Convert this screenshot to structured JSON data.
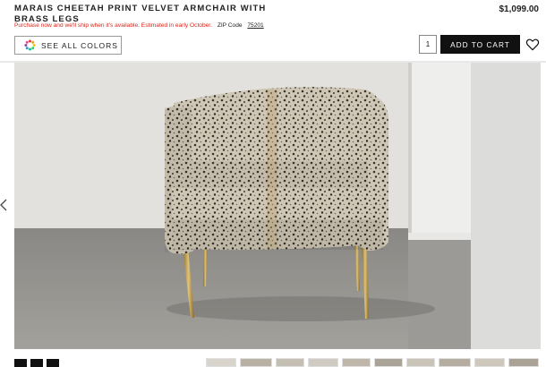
{
  "product": {
    "title": "MARAIS CHEETAH PRINT VELVET ARMCHAIR WITH BRASS LEGS",
    "price": "$1,099.00",
    "shipping_message": "Purchase now and we'll ship when it's available. Estimated in early October.",
    "zip_label": "ZIP Code",
    "zip_code": "75201"
  },
  "actions": {
    "see_colors_label": "SEE ALL COLORS",
    "quantity": "1",
    "add_to_cart_label": "ADD TO CART"
  },
  "icons": {
    "color_wheel": "color-wheel-icon",
    "wishlist": "heart-icon",
    "previous": "chevron-left-icon"
  },
  "colors": {
    "shipping_text": "#d6261b",
    "button_bg": "#111111",
    "button_text": "#ffffff"
  }
}
